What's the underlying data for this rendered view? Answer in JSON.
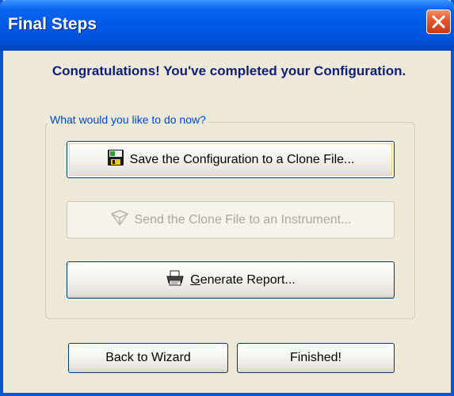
{
  "window": {
    "title": "Final Steps"
  },
  "headline": "Congratulations! You've completed your Configuration.",
  "group": {
    "legend": "What would you like to do now?",
    "actions": [
      {
        "label": "Save the Configuration to a Clone File...",
        "icon": "floppy-disk-icon",
        "enabled": true,
        "default": true
      },
      {
        "label": "Send the Clone File to an Instrument...",
        "icon": "send-arrow-icon",
        "enabled": false
      },
      {
        "label_mnemonic": "G",
        "label_rest": "enerate Report...",
        "icon": "printer-icon",
        "enabled": true
      }
    ]
  },
  "footer": {
    "back_label": "Back to Wizard",
    "finish_label": "Finished!"
  },
  "colors": {
    "titlebar": "#0058e6",
    "dialog_bg": "#ece9d8",
    "headline": "#0f1e78",
    "legend": "#0046d5",
    "close_button": "#e1542c"
  }
}
